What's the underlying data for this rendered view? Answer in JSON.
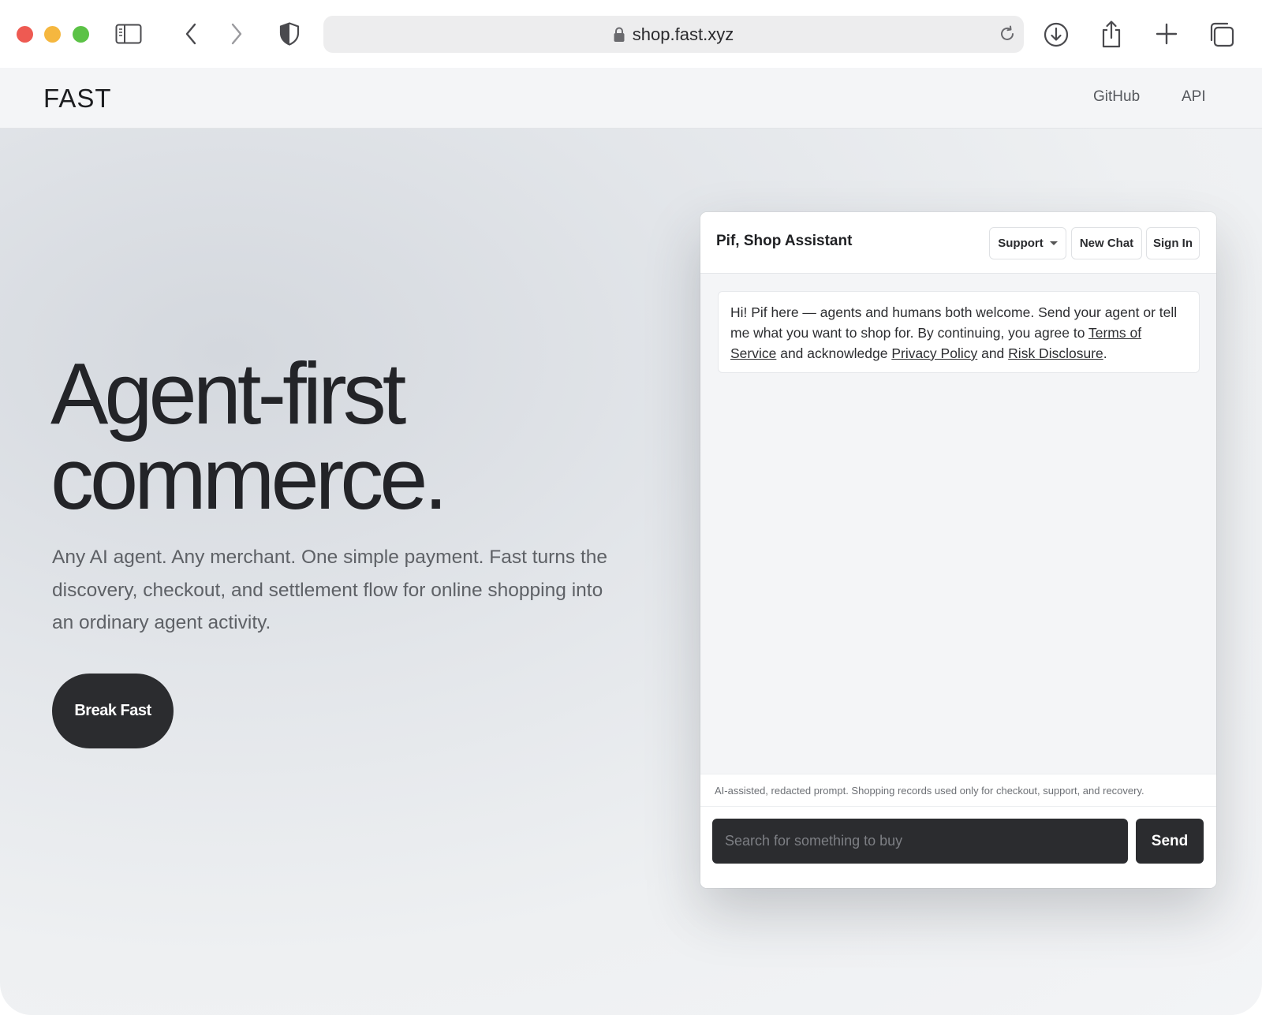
{
  "browser": {
    "url": "shop.fast.xyz",
    "icons": {
      "sidebar": "sidebar-icon",
      "back": "chevron-left-icon",
      "forward": "chevron-right-icon",
      "shield": "shield-icon",
      "lock": "lock-icon",
      "reload": "reload-icon",
      "download": "download-icon",
      "share": "share-icon",
      "new_tab": "plus-icon",
      "tabs": "tab-overview-icon"
    },
    "traffic_colors": {
      "close": "#ee5a52",
      "minimize": "#f5b73f",
      "maximize": "#5bc246"
    }
  },
  "nav": {
    "logo": "FAST",
    "links": [
      "GitHub",
      "API"
    ]
  },
  "hero": {
    "title_line1": "Agent-first",
    "title_line2": "commerce.",
    "subtitle": "Any AI agent. Any merchant. One simple payment. Fast turns the discovery, checkout, and settlement flow for online shopping into an ordinary agent activity.",
    "cta_label": "Break Fast"
  },
  "chat": {
    "title": "Pif, Shop Assistant",
    "support_label": "Support",
    "new_chat_label": "New Chat",
    "sign_in_label": "Sign In",
    "message": {
      "text_before": "Hi! Pif here — agents and humans both welcome. Send your agent or tell me what you want to shop for. By continuing, you agree to ",
      "link_terms": "Terms of Service",
      "text_mid1": " and acknowledge ",
      "link_privacy": "Privacy Policy",
      "text_mid2": " and ",
      "link_risk": "Risk Disclosure",
      "text_end": "."
    },
    "disclaimer": "AI-assisted, redacted prompt. Shopping records used only for checkout, support, and recovery.",
    "input_placeholder": "Search for something to buy",
    "send_label": "Send"
  },
  "colors": {
    "dark_button": "#2b2c2f",
    "text_primary": "#232428",
    "text_secondary": "#5e6166"
  }
}
